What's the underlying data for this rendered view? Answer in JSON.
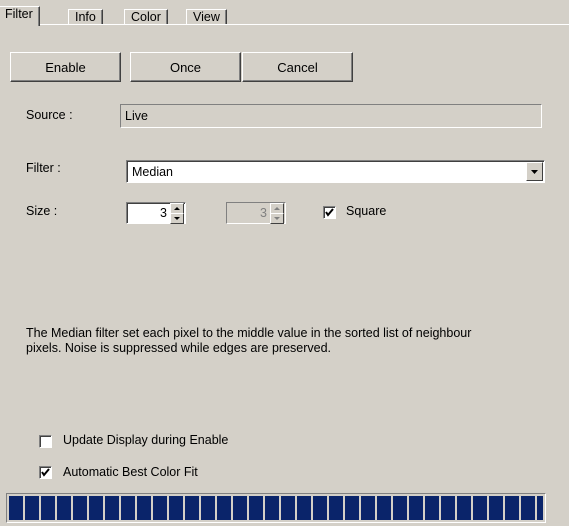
{
  "tabs": [
    {
      "label": "Filter",
      "active": true
    },
    {
      "label": "Info",
      "active": false
    },
    {
      "label": "Color",
      "active": false
    },
    {
      "label": "View",
      "active": false
    }
  ],
  "buttons": {
    "enable": "Enable",
    "once": "Once",
    "cancel": "Cancel"
  },
  "source": {
    "label": "Source :",
    "value": "Live"
  },
  "filter": {
    "label": "Filter :",
    "selected": "Median"
  },
  "size": {
    "label": "Size :",
    "value1": "3",
    "value2": "3",
    "square_label": "Square",
    "square_checked": true
  },
  "description": "The Median filter set each pixel to the middle value in the sorted list of neighbour pixels. Noise is suppressed while edges are preserved.",
  "options": {
    "update_display_label": "Update Display during Enable",
    "update_display_checked": false,
    "auto_fit_label": "Automatic Best Color Fit",
    "auto_fit_checked": true
  },
  "progress": {
    "fraction": 1.0,
    "color": "#0a246a"
  }
}
